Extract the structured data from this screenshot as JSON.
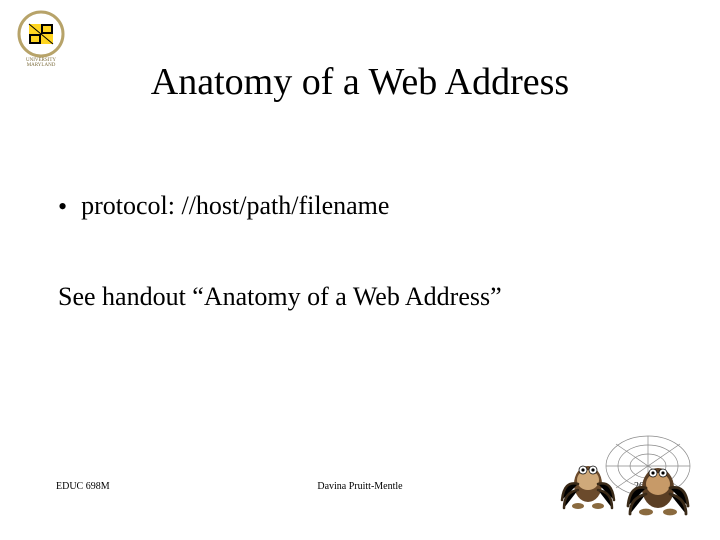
{
  "title": "Anatomy of a Web Address",
  "bullet": "protocol: //host/path/filename",
  "handout_line": "See handout “Anatomy of a Web Address”",
  "footer": {
    "left": "EDUC 698M",
    "center": "Davina Pruitt-Mentle",
    "right": "26"
  },
  "icons": {
    "logo": "university-seal",
    "decoration": "spiders-on-web"
  }
}
